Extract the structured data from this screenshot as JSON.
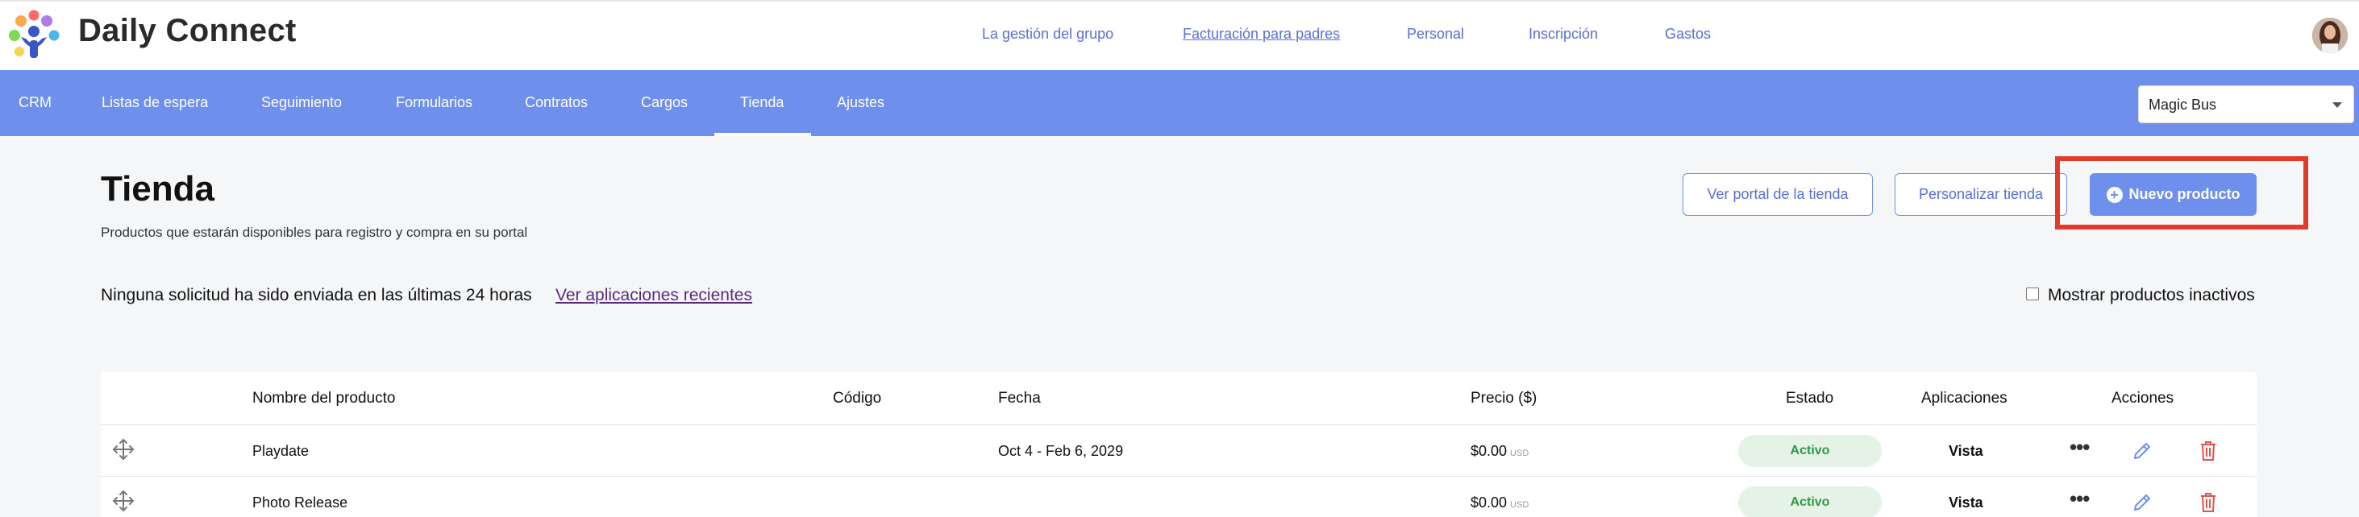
{
  "brand": {
    "name": "Daily Connect"
  },
  "top_nav": [
    {
      "label": "La gestión del grupo"
    },
    {
      "label": "Facturación para padres"
    },
    {
      "label": "Personal"
    },
    {
      "label": "Inscripción"
    },
    {
      "label": "Gastos"
    }
  ],
  "main_nav": [
    {
      "label": "CRM"
    },
    {
      "label": "Listas de espera"
    },
    {
      "label": "Seguimiento"
    },
    {
      "label": "Formularios"
    },
    {
      "label": "Contratos"
    },
    {
      "label": "Cargos"
    },
    {
      "label": "Tienda"
    },
    {
      "label": "Ajustes"
    }
  ],
  "active_nav": "Tienda",
  "location_select": {
    "value": "Magic Bus"
  },
  "page": {
    "title": "Tienda",
    "subtitle": "Productos que estarán disponibles para registro y compra en su portal"
  },
  "actions": {
    "view_portal": "Ver portal de la tienda",
    "customize": "Personalizar tienda",
    "new_product": "Nuevo producto"
  },
  "info": {
    "message": "Ninguna solicitud ha sido enviada en las últimas 24 horas",
    "link": "Ver aplicaciones recientes",
    "show_inactive": "Mostrar productos inactivos"
  },
  "table": {
    "headers": {
      "name": "Nombre del producto",
      "code": "Código",
      "date": "Fecha",
      "price": "Precio ($)",
      "status": "Estado",
      "applications": "Aplicaciones",
      "actions": "Acciones"
    },
    "rows": [
      {
        "name": "Playdate",
        "code": "",
        "date": "Oct 4 - Feb 6, 2029",
        "price": "$0.00",
        "currency": "USD",
        "status": "Activo",
        "applications": "Vista"
      },
      {
        "name": "Photo Release",
        "code": "",
        "date": "",
        "price": "$0.00",
        "currency": "USD",
        "status": "Activo",
        "applications": "Vista"
      }
    ]
  },
  "colors": {
    "accent": "#6f8fec",
    "link": "#5b6fd6",
    "status_active_bg": "#e4f3e6",
    "status_active_text": "#2d9a4a",
    "delete": "#e0534a",
    "highlight": "#e23b2a"
  }
}
